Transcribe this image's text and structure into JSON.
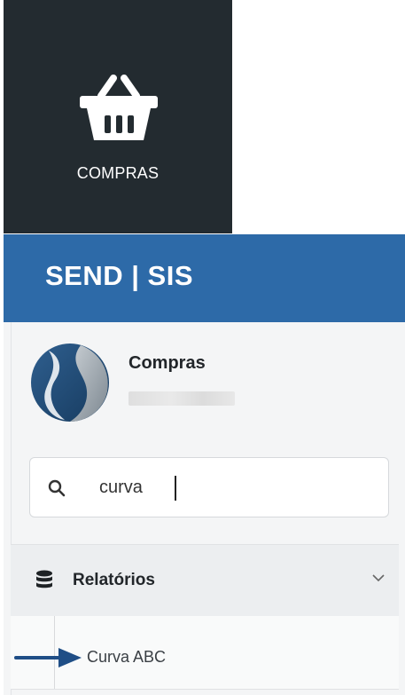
{
  "tile": {
    "label": "COMPRAS",
    "icon": "basket-icon"
  },
  "header": {
    "brand": "SEND | SIS"
  },
  "module": {
    "title": "Compras",
    "logo_icon": "send-logo-icon"
  },
  "search": {
    "value": "curva",
    "icon": "search-icon"
  },
  "menu": {
    "section": {
      "label": "Relatórios",
      "icon": "database-icon",
      "toggle_icon": "chevron-down-icon"
    },
    "items": [
      {
        "label": "Curva ABC"
      }
    ]
  },
  "annotation": {
    "icon": "arrow-right-icon"
  },
  "colors": {
    "tile_bg": "#232b30",
    "header_bg": "#2d6aa8",
    "arrow": "#1f4e86"
  }
}
